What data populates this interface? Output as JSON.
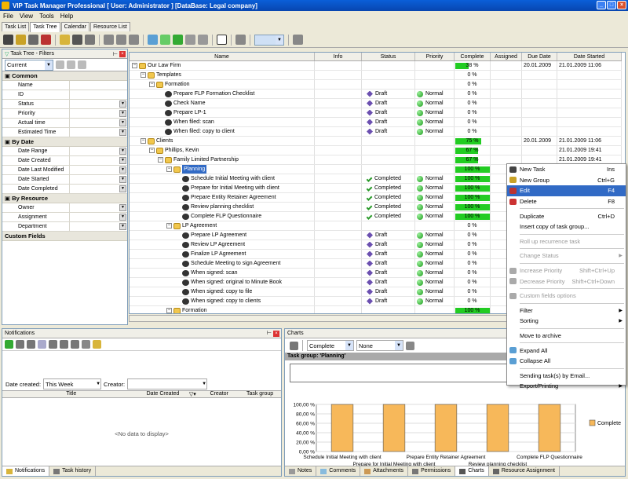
{
  "window": {
    "title": "VIP Task Manager Professional [ User: Administrator ] [DataBase: Legal company]"
  },
  "menu": [
    "File",
    "View",
    "Tools",
    "Help"
  ],
  "tabs": [
    "Task List",
    "Task Tree",
    "Calendar",
    "Resource List"
  ],
  "filters": {
    "title": "Task Tree - Filters",
    "current": "Current",
    "groups": [
      {
        "label": "Common",
        "rows": [
          "Name",
          "ID",
          "Status",
          "Priority",
          "Actual time",
          "Estimated Time"
        ],
        "dd": [
          false,
          false,
          true,
          true,
          true,
          true
        ]
      },
      {
        "label": "By Date",
        "rows": [
          "Date Range",
          "Date Created",
          "Date Last Modified",
          "Date Started",
          "Date Completed"
        ],
        "dd": [
          true,
          true,
          true,
          true,
          true
        ]
      },
      {
        "label": "By Resource",
        "rows": [
          "Owner",
          "Assignment",
          "Department"
        ],
        "dd": [
          true,
          true,
          true
        ]
      },
      {
        "label": "Custom Fields",
        "rows": [],
        "dd": []
      }
    ]
  },
  "grid": {
    "columns": [
      "Name",
      "Info",
      "Status",
      "Priority",
      "Complete",
      "Assigned",
      "Due Date",
      "Date Started"
    ],
    "rows": [
      {
        "lvl": 0,
        "type": "folder",
        "exp": "-",
        "name": "Our Law Firm",
        "status": "",
        "priority": "",
        "complete": "38 %",
        "pct": 38,
        "due": "20.01.2009",
        "started": "21.01.2009 11:06"
      },
      {
        "lvl": 1,
        "type": "folder",
        "exp": "-",
        "name": "Templates",
        "status": "",
        "priority": "",
        "complete": "0 %",
        "pct": 0,
        "due": "",
        "started": ""
      },
      {
        "lvl": 2,
        "type": "folder",
        "exp": "-",
        "name": "Formation",
        "status": "",
        "priority": "",
        "complete": "0 %",
        "pct": 0,
        "due": "",
        "started": ""
      },
      {
        "lvl": 3,
        "type": "task",
        "name": "Prepare FLP Formation Checklist",
        "status": "Draft",
        "priority": "Normal",
        "complete": "0 %",
        "pct": 0,
        "due": "",
        "started": ""
      },
      {
        "lvl": 3,
        "type": "task",
        "name": "Check Name",
        "status": "Draft",
        "priority": "Normal",
        "complete": "0 %",
        "pct": 0,
        "due": "",
        "started": ""
      },
      {
        "lvl": 3,
        "type": "task",
        "name": "Prepare LP-1",
        "status": "Draft",
        "priority": "Normal",
        "complete": "0 %",
        "pct": 0,
        "due": "",
        "started": ""
      },
      {
        "lvl": 3,
        "type": "task",
        "name": "When filed:  scan",
        "status": "Draft",
        "priority": "Normal",
        "complete": "0 %",
        "pct": 0,
        "due": "",
        "started": ""
      },
      {
        "lvl": 3,
        "type": "task",
        "name": "When filed:  copy to client",
        "status": "Draft",
        "priority": "Normal",
        "complete": "0 %",
        "pct": 0,
        "due": "",
        "started": ""
      },
      {
        "lvl": 1,
        "type": "folder",
        "exp": "-",
        "name": "Clients",
        "status": "",
        "priority": "",
        "complete": "75 %",
        "pct": 75,
        "due": "20.01.2009",
        "started": "21.01.2009 11:06"
      },
      {
        "lvl": 2,
        "type": "folder",
        "exp": "-",
        "name": "Phillips, Kevin",
        "status": "",
        "priority": "",
        "complete": "67 %",
        "pct": 67,
        "due": "",
        "started": "21.01.2009 19:41"
      },
      {
        "lvl": 3,
        "type": "folder",
        "exp": "-",
        "name": "Family Limited Partnership",
        "status": "",
        "priority": "",
        "complete": "67 %",
        "pct": 67,
        "due": "",
        "started": "21.01.2009 19:41"
      },
      {
        "lvl": 4,
        "type": "folder",
        "exp": "-",
        "name": "Planning",
        "status": "",
        "priority": "",
        "complete": "100 %",
        "pct": 100,
        "due": "",
        "started": "",
        "sel": true
      },
      {
        "lvl": 5,
        "type": "task",
        "name": "Schedule Initial Meeting with client",
        "status": "Completed",
        "priority": "Normal",
        "complete": "100 %",
        "pct": 100,
        "due": "",
        "started": ""
      },
      {
        "lvl": 5,
        "type": "task",
        "name": "Prepare for Initial Meeting with client",
        "status": "Completed",
        "priority": "Normal",
        "complete": "100 %",
        "pct": 100,
        "due": "",
        "started": ""
      },
      {
        "lvl": 5,
        "type": "task",
        "name": "Prepare Entity Retainer Agreement",
        "status": "Completed",
        "priority": "Normal",
        "complete": "100 %",
        "pct": 100,
        "due": "",
        "started": ""
      },
      {
        "lvl": 5,
        "type": "task",
        "name": "Review planning checklist",
        "status": "Completed",
        "priority": "Normal",
        "complete": "100 %",
        "pct": 100,
        "due": "",
        "started": ""
      },
      {
        "lvl": 5,
        "type": "task",
        "name": "Complete FLP Questionnaire",
        "status": "Completed",
        "priority": "Normal",
        "complete": "100 %",
        "pct": 100,
        "due": "",
        "started": ""
      },
      {
        "lvl": 4,
        "type": "folder",
        "exp": "-",
        "name": "LP Agreement",
        "status": "",
        "priority": "",
        "complete": "0 %",
        "pct": 0,
        "due": "",
        "started": ""
      },
      {
        "lvl": 5,
        "type": "task",
        "name": "Prepare LP Agreement",
        "status": "Draft",
        "priority": "Normal",
        "complete": "0 %",
        "pct": 0,
        "due": "",
        "started": ""
      },
      {
        "lvl": 5,
        "type": "task",
        "name": "Review LP Agreement",
        "status": "Draft",
        "priority": "Normal",
        "complete": "0 %",
        "pct": 0,
        "due": "",
        "started": ""
      },
      {
        "lvl": 5,
        "type": "task",
        "name": "Finalize LP Agreement",
        "status": "Draft",
        "priority": "Normal",
        "complete": "0 %",
        "pct": 0,
        "due": "",
        "started": ""
      },
      {
        "lvl": 5,
        "type": "task",
        "name": "Schedule Meeting to sign Agreement",
        "status": "Draft",
        "priority": "Normal",
        "complete": "0 %",
        "pct": 0,
        "due": "",
        "started": ""
      },
      {
        "lvl": 5,
        "type": "task",
        "name": "When signed:  scan",
        "status": "Draft",
        "priority": "Normal",
        "complete": "0 %",
        "pct": 0,
        "due": "",
        "started": ""
      },
      {
        "lvl": 5,
        "type": "task",
        "name": "When signed:  original to Minute Book",
        "status": "Draft",
        "priority": "Normal",
        "complete": "0 %",
        "pct": 0,
        "due": "",
        "started": ""
      },
      {
        "lvl": 5,
        "type": "task",
        "name": "When signed:  copy to file",
        "status": "Draft",
        "priority": "Normal",
        "complete": "0 %",
        "pct": 0,
        "due": "",
        "started": ""
      },
      {
        "lvl": 5,
        "type": "task",
        "name": "When signed:  copy to clients",
        "status": "Draft",
        "priority": "Normal",
        "complete": "0 %",
        "pct": 0,
        "due": "",
        "started": ""
      },
      {
        "lvl": 4,
        "type": "folder",
        "exp": "-",
        "name": "Formation",
        "status": "",
        "priority": "",
        "complete": "100 %",
        "pct": 100,
        "due": "",
        "started": ""
      }
    ]
  },
  "context_menu": [
    {
      "label": "New Task",
      "shortcut": "Ins",
      "icon": true
    },
    {
      "label": "New Group",
      "shortcut": "Ctrl+G",
      "icon": true
    },
    {
      "label": "Edit",
      "shortcut": "F4",
      "icon": true,
      "hl": true
    },
    {
      "label": "Delete",
      "shortcut": "F8",
      "icon": true
    },
    {
      "sep": true
    },
    {
      "label": "Duplicate",
      "shortcut": "Ctrl+D"
    },
    {
      "label": "Insert copy of task group..."
    },
    {
      "sep": true
    },
    {
      "label": "Roll up recurrence task",
      "dis": true
    },
    {
      "sep": true
    },
    {
      "label": "Change Status",
      "dis": true,
      "sub": true
    },
    {
      "sep": true
    },
    {
      "label": "Increase Priority",
      "shortcut": "Shift+Ctrl+Up",
      "dis": true,
      "icon": true
    },
    {
      "label": "Decrease Priority",
      "shortcut": "Shift+Ctrl+Down",
      "dis": true,
      "icon": true
    },
    {
      "sep": true
    },
    {
      "label": "Custom fields options",
      "dis": true,
      "icon": true
    },
    {
      "sep": true
    },
    {
      "label": "Filter",
      "sub": true
    },
    {
      "label": "Sorting",
      "sub": true
    },
    {
      "sep": true
    },
    {
      "label": "Move to archive"
    },
    {
      "sep": true
    },
    {
      "label": "Expand All",
      "icon": true
    },
    {
      "label": "Collapse All",
      "icon": true
    },
    {
      "sep": true
    },
    {
      "label": "Sending task(s) by Email..."
    },
    {
      "label": "Export/Printing",
      "sub": true
    }
  ],
  "notifications": {
    "title": "Notifications",
    "date_created_label": "Date created:",
    "date_created_value": "This Week",
    "creator_label": "Creator:",
    "columns": [
      "Title",
      "Date Created",
      "Creator",
      "Task group"
    ],
    "empty": "<No data to display>",
    "tabs": [
      "Notifications",
      "Task history"
    ]
  },
  "charts_panel": {
    "title": "Charts",
    "combo1": "Complete",
    "combo2": "None",
    "group_label": "Task group: 'Planning'",
    "tabs": [
      "Notes",
      "Comments",
      "Attachments",
      "Permissions",
      "Charts",
      "Resource Assignment"
    ]
  },
  "chart_data": {
    "type": "bar",
    "categories": [
      "Schedule Initial Meeting with client",
      "Prepare for Initial Meeting with client",
      "Prepare Entity Retainer Agreement",
      "Review planning checklist",
      "Complete FLP Questionnaire"
    ],
    "series": [
      {
        "name": "Complete",
        "values": [
          100,
          100,
          100,
          100,
          100
        ]
      }
    ],
    "yticks": [
      "0,00 %",
      "20,00 %",
      "40,00 %",
      "60,00 %",
      "80,00 %",
      "100,00 %"
    ],
    "ylim": [
      0,
      100
    ],
    "legend": "right",
    "bar_color": "#f7b85a"
  }
}
